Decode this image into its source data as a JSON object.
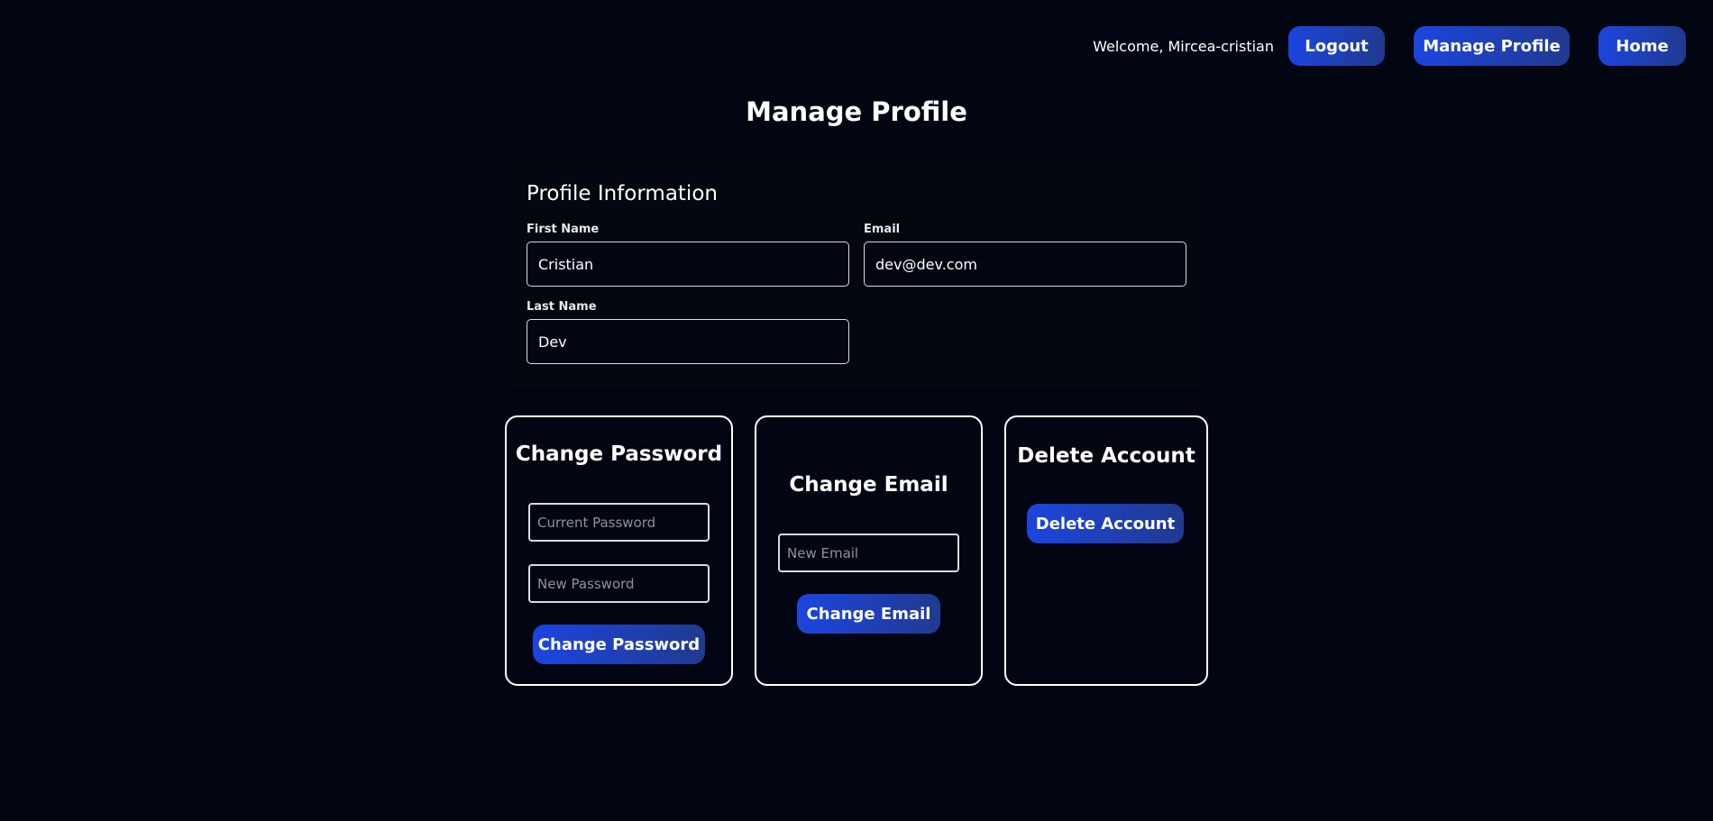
{
  "nav": {
    "welcome": "Welcome, Mircea-cristian",
    "logout": "Logout",
    "manage_profile": "Manage Profile",
    "home": "Home"
  },
  "page_title": "Manage Profile",
  "profile": {
    "heading": "Profile Information",
    "first_name_label": "First Name",
    "first_name": "Cristian",
    "email_label": "Email",
    "email": "dev@dev.com",
    "last_name_label": "Last Name",
    "last_name": "Dev"
  },
  "change_password": {
    "title": "Change Password",
    "current_placeholder": "Current Password",
    "new_placeholder": "New Password",
    "button": "Change Password"
  },
  "change_email": {
    "title": "Change Email",
    "new_placeholder": "New Email",
    "button": "Change Email"
  },
  "delete_account": {
    "title": "Delete Account",
    "button": "Delete Account"
  },
  "colors": {
    "background": "#020612",
    "button_start": "#1c45e0",
    "button_end": "#213a8f",
    "border": "#ffffff"
  }
}
